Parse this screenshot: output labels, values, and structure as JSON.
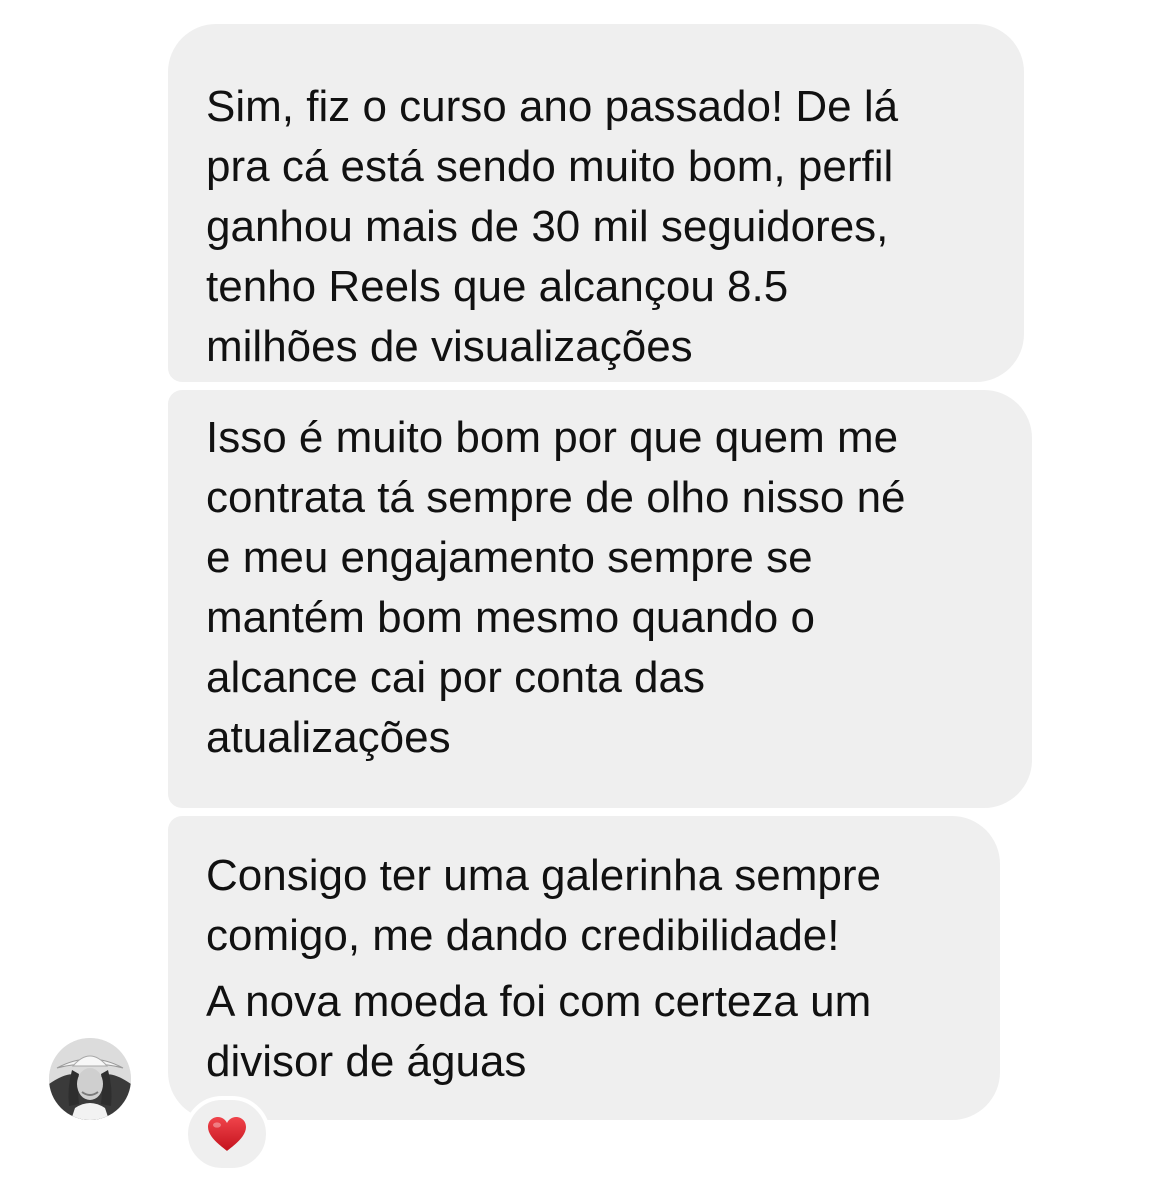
{
  "thread": {
    "messages": [
      {
        "lines": [
          "Sim, fiz o curso ano passado! De lá",
          "pra cá está sendo muito bom, perfil",
          "ganhou mais de 30 mil seguidores,",
          "tenho Reels que alcançou 8.5",
          "milhões de visualizações"
        ]
      },
      {
        "lines": [
          "Isso é muito bom por que quem me",
          "contrata tá sempre de olho nisso né",
          "e meu engajamento sempre se",
          "mantém bom mesmo quando o",
          "alcance cai por conta das",
          "atualizações"
        ]
      },
      {
        "paragraphs": [
          {
            "lines": [
              "Consigo ter uma galerinha sempre",
              "comigo, me dando credibilidade!"
            ]
          },
          {
            "lines": [
              "A nova moeda foi com certeza um",
              "divisor de águas"
            ]
          }
        ]
      }
    ],
    "reaction": {
      "icon": "red-heart-icon",
      "color": "#e0242c"
    },
    "avatar": {
      "icon": "profile-photo-avatar"
    }
  },
  "colors": {
    "bubble_background": "#efefef",
    "text": "#111111",
    "page_background": "#ffffff"
  }
}
